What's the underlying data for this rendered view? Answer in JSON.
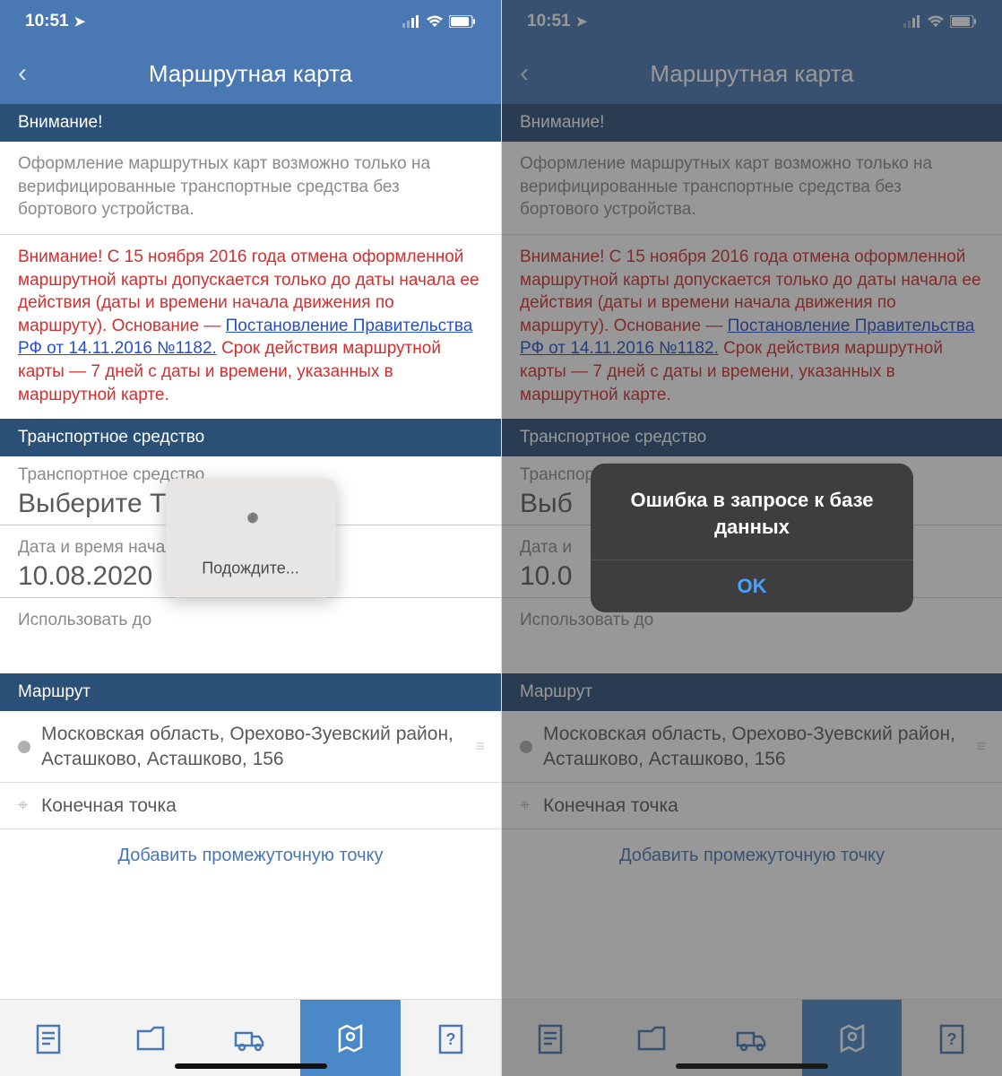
{
  "status": {
    "time": "10:51"
  },
  "nav": {
    "title": "Маршрутная карта"
  },
  "sections": {
    "attention": "Внимание!",
    "vehicle": "Транспортное средство",
    "route": "Маршрут"
  },
  "info_gray": "Оформление маршрутных карт возможно только на верифицированные транспортные средства без бортового устройства.",
  "info_red_pre": "Внимание! С 15 ноября 2016 года отмена оформленной маршрутной карты допускается только до даты начала ее действия (даты и времени начала движения по маршруту). Основание — ",
  "info_red_link": "Постановление Правительства РФ от 14.11.2016 №1182.",
  "info_red_post": " Срок действия маршрутной карты — 7 дней с даты и времени, указанных в маршрутной карте.",
  "fields": {
    "vehicle_label": "Транспортное средство",
    "vehicle_value": "Выберите ТС",
    "date_label": "Дата и время начала",
    "date_label_short_r": "Дата и",
    "date_value": "10.08.2020",
    "date_value_short_r": "10.0",
    "vehicle_value_short_r": "Выб",
    "until_label": "Использовать до"
  },
  "route": {
    "start": "Московская область, Орехово-Зуевский район, Асташково, Асташково, 156",
    "end": "Конечная точка",
    "add": "Добавить промежуточную точку"
  },
  "loading": {
    "text": "Подождите..."
  },
  "alert": {
    "msg": "Ошибка в запросе к базе данных",
    "ok": "OK"
  }
}
